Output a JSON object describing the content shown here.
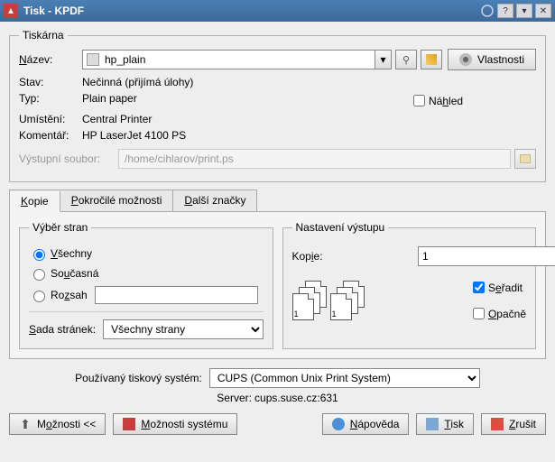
{
  "window": {
    "title": "Tisk - KPDF"
  },
  "printer_box": {
    "legend": "Tiskárna",
    "name_label": "Název:",
    "name_value": "hp_plain",
    "properties_btn": "Vlastnosti",
    "state_label": "Stav:",
    "state_value": "Nečinná (přijímá úlohy)",
    "type_label": "Typ:",
    "type_value": "Plain paper",
    "location_label": "Umístění:",
    "location_value": "Central Printer",
    "comment_label": "Komentář:",
    "comment_value": "HP LaserJet 4100 PS",
    "preview_label": "Náhled",
    "output_label": "Výstupní soubor:",
    "output_value": "/home/cihlarov/print.ps"
  },
  "tabs": {
    "copies": "Kopie",
    "advanced": "Pokročilé možnosti",
    "marks": "Další značky"
  },
  "page_sel": {
    "legend": "Výběr stran",
    "all": "Všechny",
    "current": "Současná",
    "range": "Rozsah",
    "pageset_label": "Sada stránek:",
    "pageset_value": "Všechny strany"
  },
  "output": {
    "legend": "Nastavení výstupu",
    "copies_label": "Kopie:",
    "copies_value": "1",
    "collate": "Seřadit",
    "reverse": "Opačně"
  },
  "system": {
    "label": "Používaný tiskový systém:",
    "value": "CUPS (Common Unix Print System)",
    "server_label": "Server:",
    "server_value": "cups.suse.cz:631"
  },
  "buttons": {
    "options": "Možnosti <<",
    "sys_options": "Možnosti systému",
    "help": "Nápověda",
    "print": "Tisk",
    "cancel": "Zrušit"
  }
}
